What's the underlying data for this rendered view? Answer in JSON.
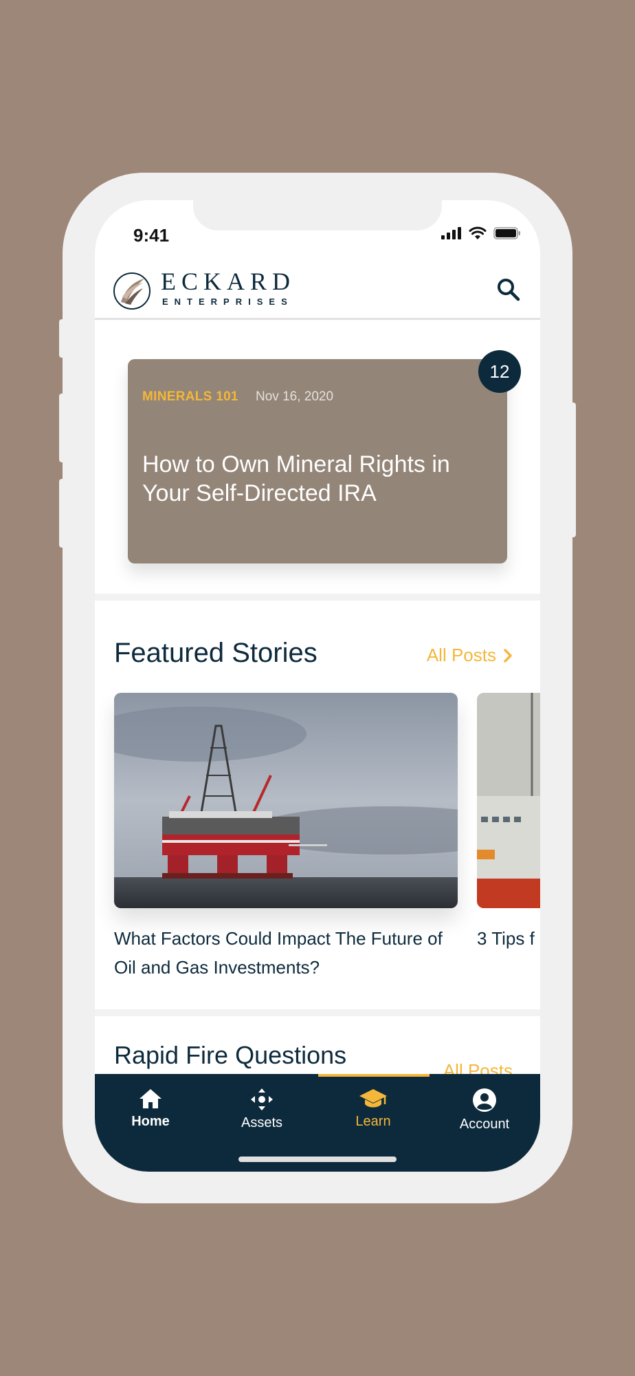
{
  "status_bar": {
    "time": "9:41"
  },
  "brand": {
    "name": "ECKARD",
    "subtitle": "ENTERPRISES"
  },
  "hero": {
    "category": "MINERALS 101",
    "date": "Nov 16, 2020",
    "title": "How to Own Mineral Rights in Your Self-Directed IRA",
    "badge_count": "12"
  },
  "featured": {
    "title": "Featured Stories",
    "all_posts": "All Posts",
    "stories": [
      {
        "title": "What Factors Could Impact The Future of Oil and Gas Investments?"
      },
      {
        "title": "3 Tips f"
      }
    ]
  },
  "rapid_fire": {
    "title": "Rapid Fire Questions",
    "all_posts": "All Posts"
  },
  "nav": {
    "items": [
      {
        "label": "Home",
        "icon": "home-icon"
      },
      {
        "label": "Assets",
        "icon": "assets-icon"
      },
      {
        "label": "Learn",
        "icon": "graduation-cap-icon",
        "active": true
      },
      {
        "label": "Account",
        "icon": "account-icon"
      }
    ]
  },
  "colors": {
    "background": "#9d8779",
    "navy": "#0d2a3c",
    "accent": "#f4b73a",
    "hero_card": "#938577"
  }
}
